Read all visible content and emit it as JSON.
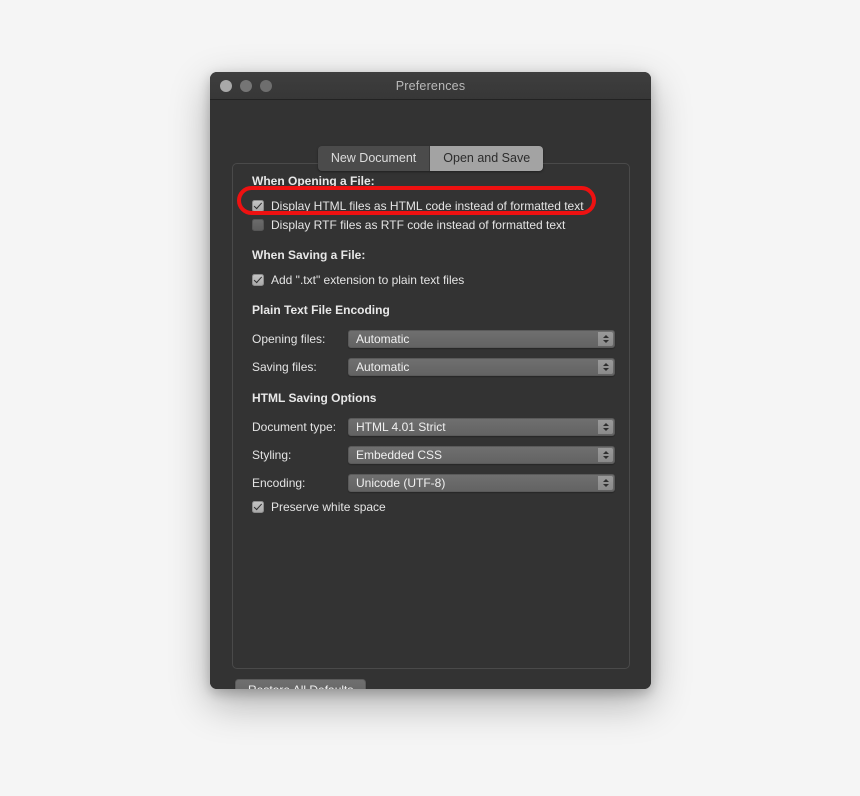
{
  "window": {
    "title": "Preferences",
    "controls": {
      "close": "close-button",
      "minimize": "minimize-button",
      "maximize": "maximize-button"
    }
  },
  "tabs": [
    {
      "label": "New Document",
      "selected": false
    },
    {
      "label": "Open and Save",
      "selected": true
    }
  ],
  "sections": {
    "opening": {
      "title": "When Opening a File:",
      "options": [
        {
          "label": "Display HTML files as HTML code instead of formatted text",
          "checked": true,
          "highlighted": true
        },
        {
          "label": "Display RTF files as RTF code instead of formatted text",
          "checked": false,
          "highlighted": false
        }
      ]
    },
    "saving": {
      "title": "When Saving a File:",
      "options": [
        {
          "label": "Add \".txt\" extension to plain text files",
          "checked": true
        }
      ]
    },
    "encoding": {
      "title": "Plain Text File Encoding",
      "fields": [
        {
          "label": "Opening files:",
          "value": "Automatic"
        },
        {
          "label": "Saving files:",
          "value": "Automatic"
        }
      ]
    },
    "html_saving": {
      "title": "HTML Saving Options",
      "fields": [
        {
          "label": "Document type:",
          "value": "HTML 4.01 Strict"
        },
        {
          "label": "Styling:",
          "value": "Embedded CSS"
        },
        {
          "label": "Encoding:",
          "value": "Unicode (UTF-8)"
        }
      ],
      "options": [
        {
          "label": "Preserve white space",
          "checked": true
        }
      ]
    }
  },
  "footer": {
    "restore_label": "Restore All Defaults"
  },
  "colors": {
    "window_bg": "#333333",
    "titlebar_bg": "#3a3a3a",
    "text": "#e4e4e4",
    "tab_selected_bg": "#a3a3a3",
    "annotation": "#ee1111",
    "backdrop": "#f5f5f5"
  }
}
